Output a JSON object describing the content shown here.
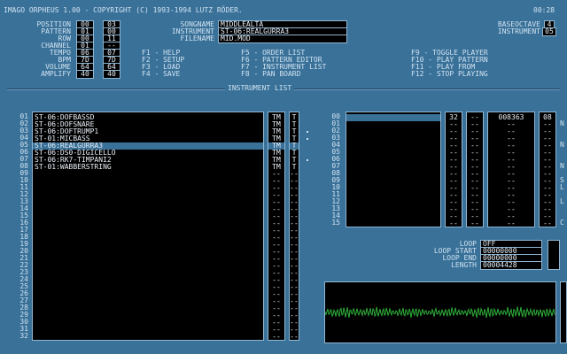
{
  "title_bar": {
    "title": "IMAGO ORPHEUS 1.00 - COPYRIGHT (C) 1993-1994 LUTZ RÖDER.",
    "clock": "00:28"
  },
  "status_panel": {
    "labels": [
      "POSITION",
      "PATTERN",
      "ROW",
      "CHANNEL",
      "TEMPO",
      "BPM",
      "VOLUME",
      "AMPLIFY"
    ],
    "col1": [
      "00",
      "01",
      "00",
      "01",
      "06",
      "7D",
      "64",
      "40"
    ],
    "col2": [
      "03",
      "00",
      "11",
      "--",
      "07",
      "7D",
      "64",
      "40"
    ]
  },
  "song_info": {
    "songname_label": "SONGNAME",
    "songname_value": "MIDDLEALTA",
    "instrument_label": "INSTRUMENT",
    "instrument_value": "ST-06:REALGURRA3",
    "filename_label": "FILENAME",
    "filename_value": "MID.MOD"
  },
  "octave": {
    "baseoctave_label": "BASEOCTAVE",
    "baseoctave_value": "4",
    "instrument_label": "INSTRUMENT",
    "instrument_value": "05"
  },
  "function_keys": [
    [
      "F1 - HELP",
      "F5 - ORDER LIST",
      "F9 - TOGGLE PLAYER"
    ],
    [
      "F2 - SETUP",
      "F6 - PATTERN EDITOR",
      "F10 - PLAY PATTERN"
    ],
    [
      "F3 - LOAD",
      "F7 - INSTRUMENT LIST",
      "F11 - PLAY FROM"
    ],
    [
      "F4 - SAVE",
      "F8 - PAN BOARD",
      "F12 - STOP PLAYING"
    ]
  ],
  "instrument_list": {
    "heading": "INSTRUMENT LIST",
    "row_numbers": [
      "01",
      "02",
      "03",
      "04",
      "05",
      "06",
      "07",
      "08",
      "09",
      "10",
      "11",
      "12",
      "13",
      "14",
      "15",
      "16",
      "17",
      "18",
      "19",
      "20",
      "21",
      "22",
      "23",
      "24",
      "25",
      "26",
      "27",
      "28",
      "29",
      "30",
      "31",
      "32"
    ],
    "names": [
      "ST-06:DOFBASSD",
      "ST-06:DOFSNARE",
      "ST-06:DOFTRUMP1",
      "ST-01:MICBASS",
      "ST-06:REALGURRA3",
      "ST-06:DS0-DIGICELLO",
      "ST-06:RK7-TIMPANI2",
      "ST-01:WABBERSTRING"
    ],
    "selected_index": 4,
    "tm_col": [
      "TM",
      "TM",
      "TM",
      "TM",
      "TM",
      "TM",
      "TM",
      "TM"
    ],
    "t_col": [
      "T",
      "T",
      "T",
      "T",
      "T",
      "T",
      "T",
      "T"
    ],
    "empty_mark": "--"
  },
  "sample_panel": {
    "row_numbers": [
      "00",
      "01",
      "02",
      "03",
      "04",
      "05",
      "06",
      "07",
      "08",
      "09",
      "10",
      "11",
      "12",
      "13",
      "14",
      "15"
    ],
    "first_row": {
      "c1": "32",
      "c2": "--",
      "c3": "008363",
      "c4": "08"
    },
    "empty_mark": "--",
    "side_letters": [
      "N",
      "N",
      "N",
      "S",
      "L",
      "L",
      "C"
    ]
  },
  "loop_info": {
    "loop_label": "LOOP",
    "loop_value": "OFF",
    "loop_start_label": "LOOP START",
    "loop_start_value": "00000000",
    "loop_end_label": "LOOP END",
    "loop_end_value": "00000000",
    "length_label": "LENGTH",
    "length_value": "00004428"
  },
  "colors": {
    "background": "#3a7199",
    "panel": "#000000",
    "waveform": "#2fae3a"
  }
}
